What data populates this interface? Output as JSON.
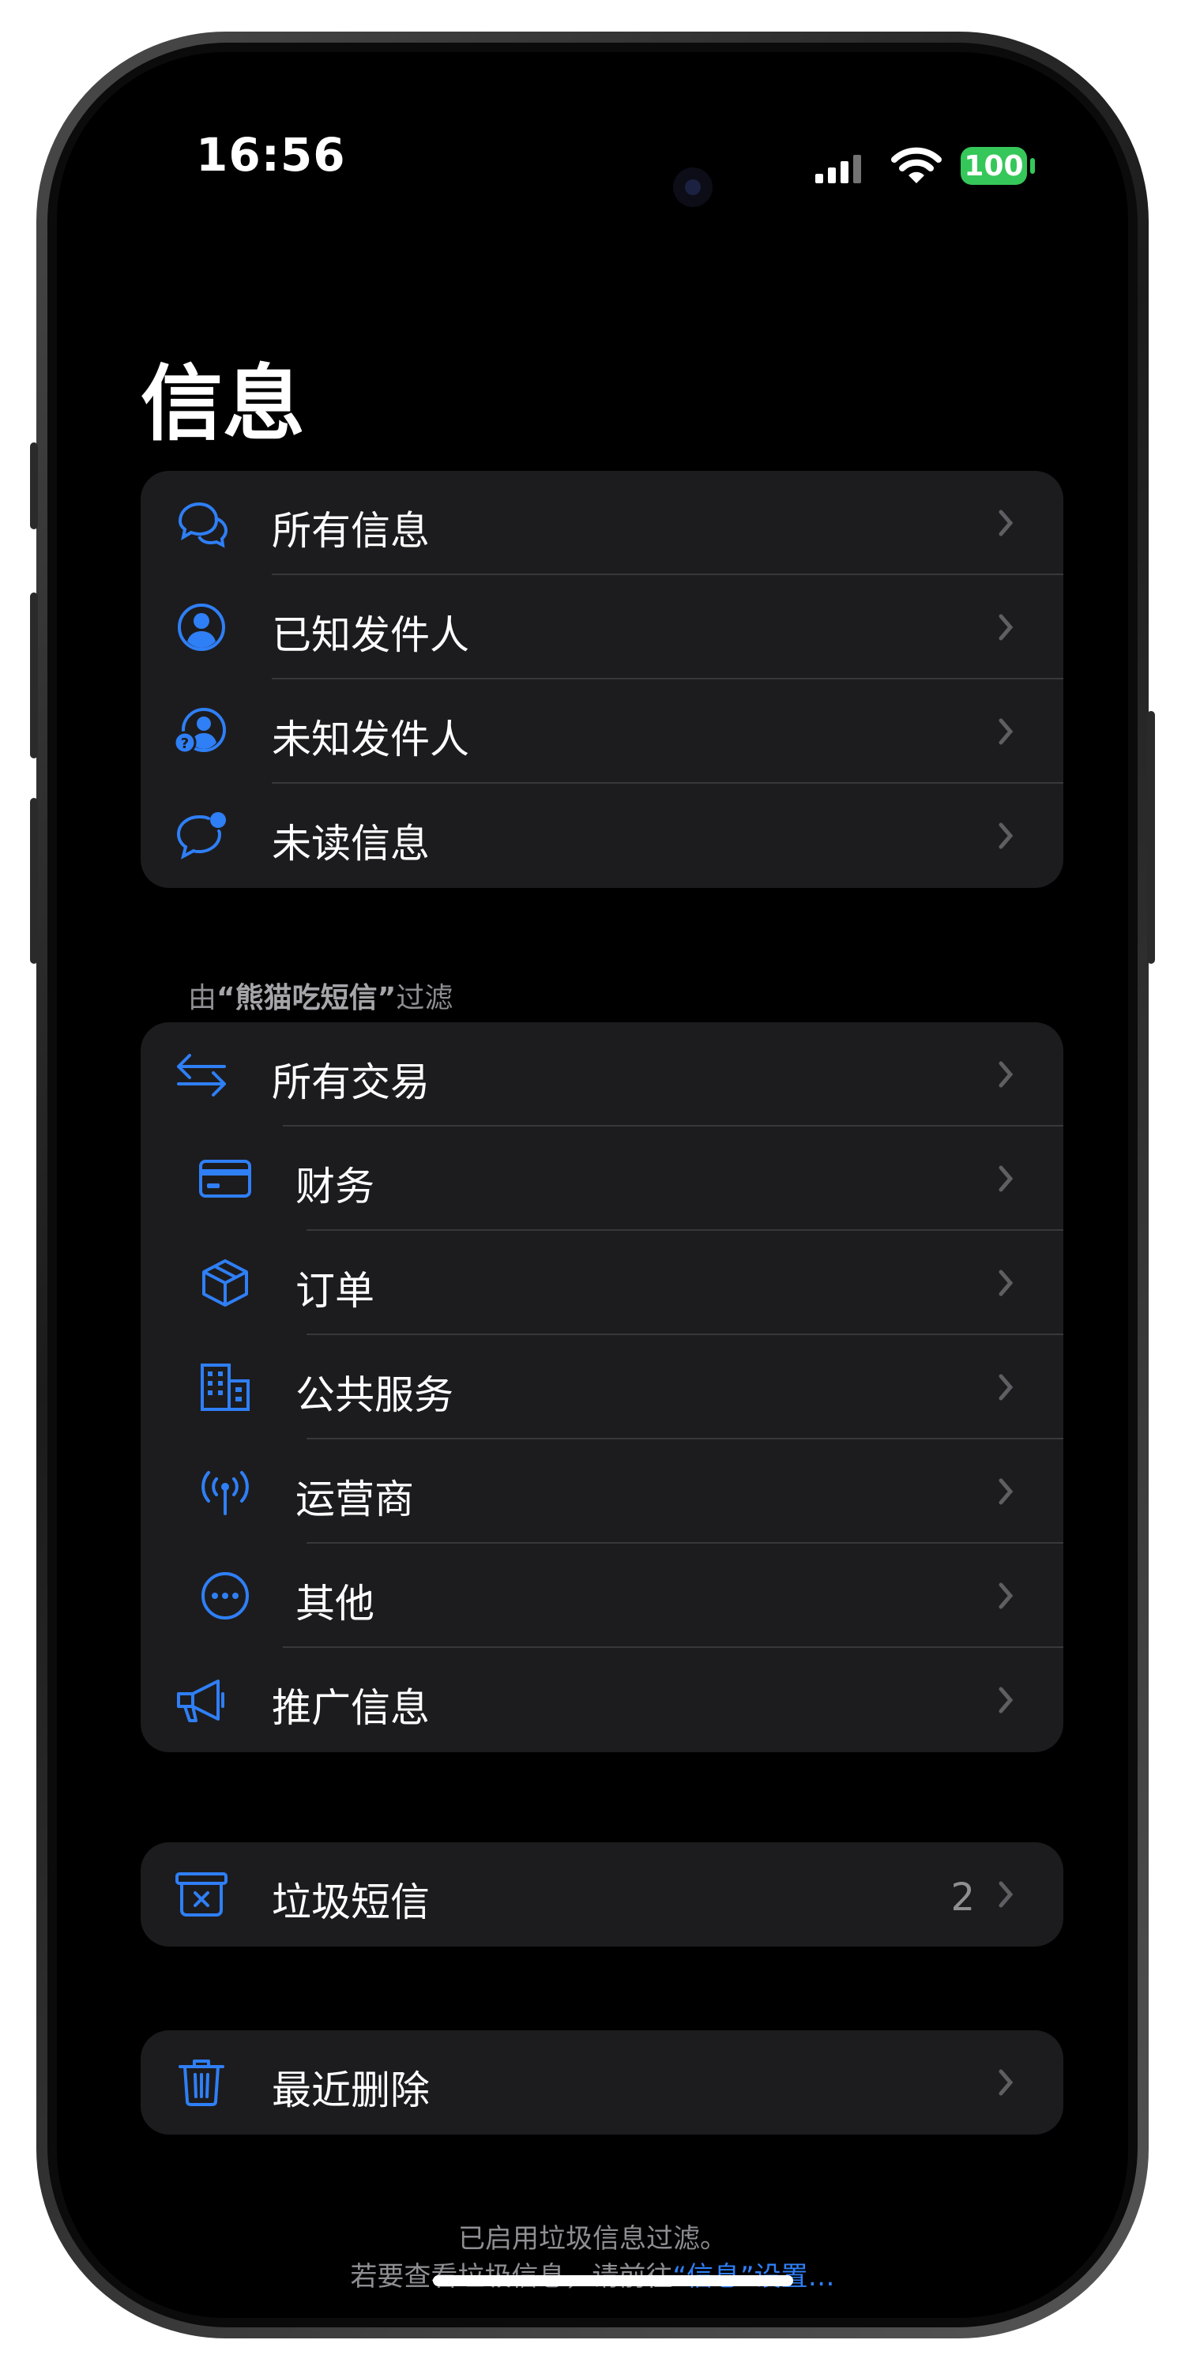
{
  "status_bar": {
    "time": "16:56",
    "battery": "100"
  },
  "page": {
    "title": "信息"
  },
  "group_main": {
    "items": [
      {
        "label": "所有信息",
        "icon": "chat-bubbles-icon"
      },
      {
        "label": "已知发件人",
        "icon": "person-circle-icon"
      },
      {
        "label": "未知发件人",
        "icon": "person-question-icon"
      },
      {
        "label": "未读信息",
        "icon": "bubble-dot-icon"
      }
    ]
  },
  "filter_section": {
    "prefix": "由",
    "app_name": "“熊猫吃短信”",
    "suffix": "过滤"
  },
  "group_filter": {
    "items": [
      {
        "label": "所有交易",
        "icon": "arrows-exchange-icon"
      },
      {
        "label": "财务",
        "icon": "credit-card-icon"
      },
      {
        "label": "订单",
        "icon": "box-icon"
      },
      {
        "label": "公共服务",
        "icon": "building-icon"
      },
      {
        "label": "运营商",
        "icon": "antenna-icon"
      },
      {
        "label": "其他",
        "icon": "ellipsis-circle-icon"
      },
      {
        "label": "推广信息",
        "icon": "megaphone-icon"
      }
    ]
  },
  "group_junk": {
    "label": "垃圾短信",
    "count": "2",
    "icon": "junk-tray-icon"
  },
  "group_deleted": {
    "label": "最近删除",
    "icon": "trash-icon"
  },
  "footer": {
    "line1": "已启用垃圾信息过滤。",
    "line2_prefix": "若要查看垃圾信息，请前往",
    "line2_link": "“信息”设置…"
  },
  "colors": {
    "accent": "#2f7ff6",
    "background": "#000000",
    "cell": "#1c1c1e",
    "separator": "#38383a",
    "secondary_text": "#8e8e93",
    "battery": "#35c759"
  }
}
